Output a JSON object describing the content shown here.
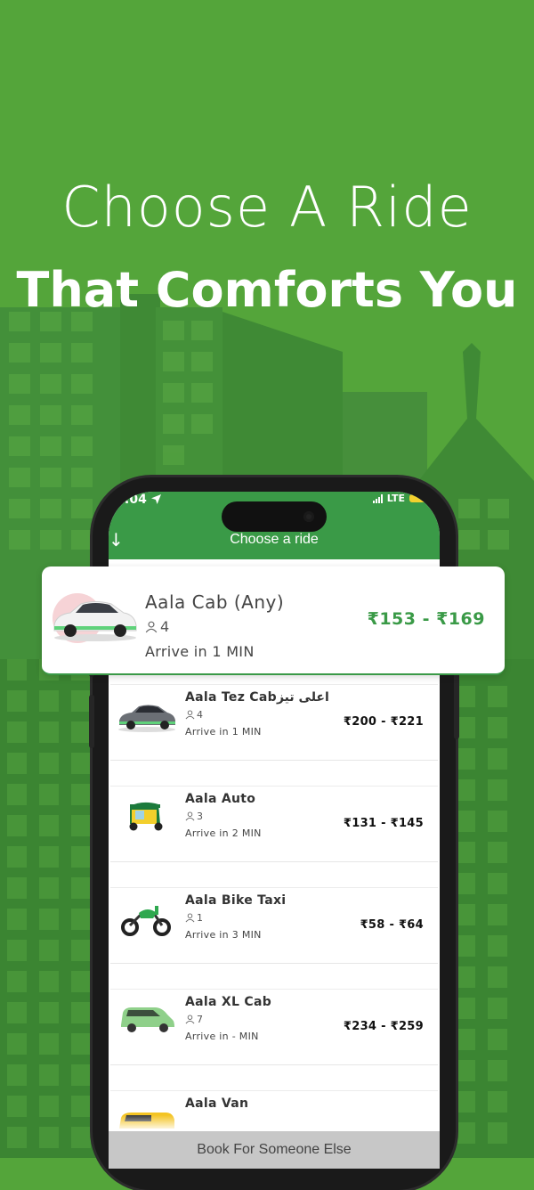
{
  "colors": {
    "background": "#54a53a",
    "header_green": "#3a9a47",
    "price_green": "#3a9a47",
    "book_bar": "#c7c7c7"
  },
  "headline": {
    "line1": "Choose A Ride",
    "line2": "That Comforts You"
  },
  "status_bar": {
    "time": "1:04",
    "network": "LTE",
    "location_icon": "location-arrow-icon"
  },
  "header": {
    "title": "Choose a ride",
    "back_icon": "arrow-down-icon"
  },
  "featured_ride": {
    "name": "Aala Cab (Any)",
    "seats": "4",
    "arrive": "Arrive in 1 MIN",
    "price": "₹153 - ₹169",
    "icon": "white-car-icon"
  },
  "rides": [
    {
      "name": "Aala Tez Cabاعلی تیز",
      "seats": "4",
      "arrive": "Arrive in 1 MIN",
      "price": "₹200 - ₹221",
      "icon": "sedan-car-icon"
    },
    {
      "name": "Aala Auto",
      "seats": "3",
      "arrive": "Arrive in 2 MIN",
      "price": "₹131 - ₹145",
      "icon": "auto-rickshaw-icon"
    },
    {
      "name": "Aala Bike Taxi",
      "seats": "1",
      "arrive": "Arrive in 3 MIN",
      "price": "₹58 - ₹64",
      "icon": "motorbike-icon"
    },
    {
      "name": "Aala XL Cab",
      "seats": "7",
      "arrive": "Arrive in - MIN",
      "price": "₹234 - ₹259",
      "icon": "minivan-icon"
    },
    {
      "name": "Aala Van",
      "seats": "",
      "arrive": "",
      "price": "",
      "icon": "yellow-van-icon"
    }
  ],
  "book_button": "Book For Someone Else"
}
